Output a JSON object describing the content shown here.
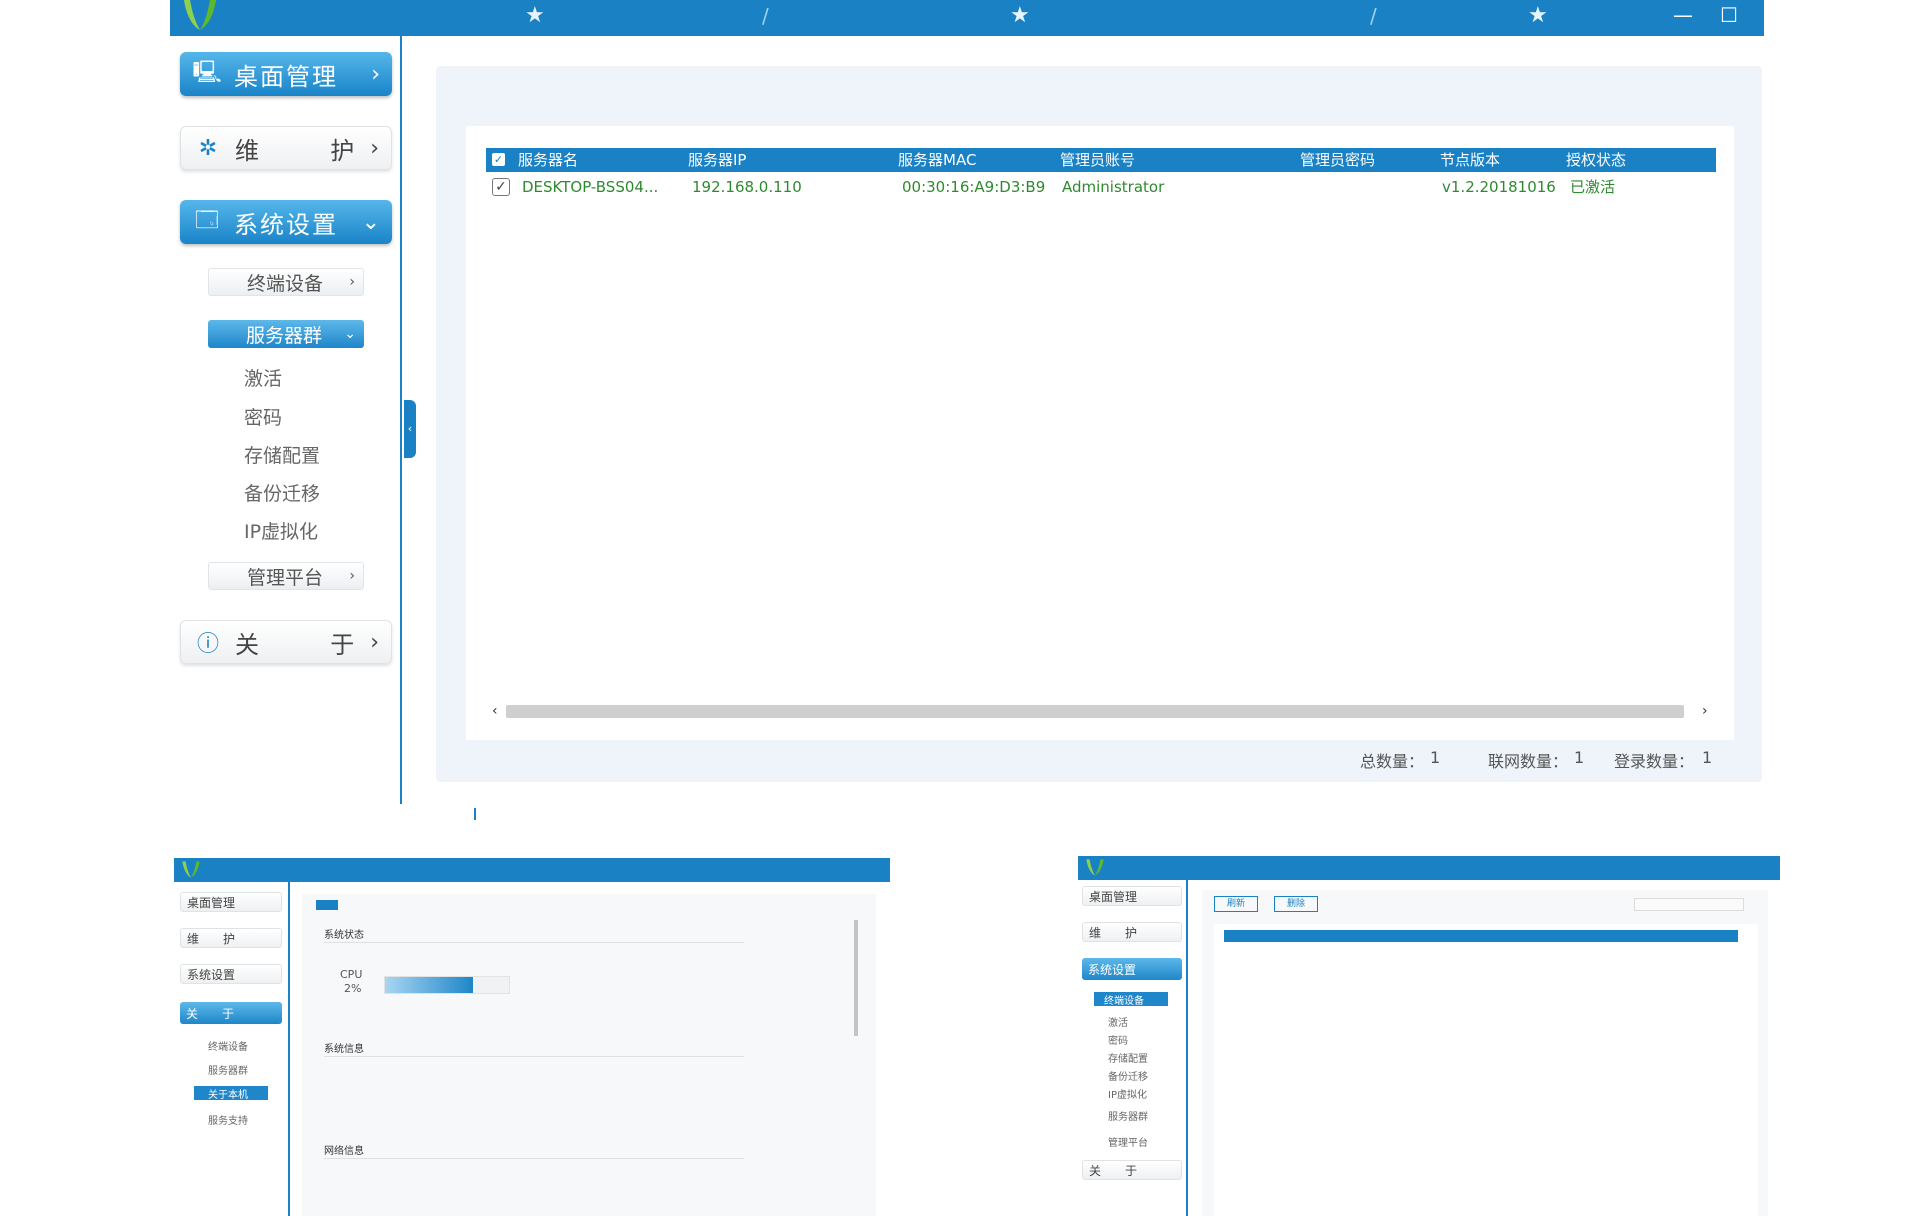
{
  "colors": {
    "accent": "#1a82c4",
    "row_text": "#2f8a2f"
  },
  "window": {
    "logo": "leaf-logo-icon"
  },
  "sidebar": {
    "desktop_mgmt": "桌面管理",
    "maintenance": [
      "维",
      "护"
    ],
    "system_settings": "系统设置",
    "terminal_devices": "终端设备",
    "server_group": "服务器群",
    "sub_items": [
      "激活",
      "密码",
      "存储配置",
      "备份迁移",
      "IP虚拟化"
    ],
    "mgmt_platform": "管理平台",
    "about": [
      "关",
      "于"
    ]
  },
  "table": {
    "headers": [
      "服务器名",
      "服务器IP",
      "服务器MAC",
      "管理员账号",
      "管理员密码",
      "节点版本",
      "授权状态"
    ],
    "rows": [
      {
        "name": "DESKTOP-BSS04...",
        "ip": "192.168.0.110",
        "mac": "00:30:16:A9:D3:B9",
        "admin": "Administrator",
        "password": "",
        "version": "v1.2.20181016",
        "status": "已激活"
      }
    ]
  },
  "footer": {
    "total_label": "总数量：",
    "total_value": "1",
    "online_label": "联网数量：",
    "online_value": "1",
    "login_label": "登录数量：",
    "login_value": "1"
  },
  "thumb_left": {
    "nav": [
      "桌面管理",
      "维　　护",
      "系统设置",
      "关　　于"
    ],
    "subs": [
      "终端设备",
      "服务器群",
      "关于本机",
      "服务支持"
    ],
    "section1": "系统状态",
    "section2": "系统信息",
    "section3": "网络信息",
    "cpu": "CPU",
    "cpu_pct": "2%"
  },
  "thumb_right": {
    "nav": [
      "桌面管理",
      "维　　护",
      "系统设置",
      "关　　于"
    ],
    "subs": [
      "终端设备",
      "激活",
      "密码",
      "存储配置",
      "备份迁移",
      "IP虚拟化",
      "服务器群",
      "管理平台"
    ],
    "tab1": "刷新",
    "tab2": "删除"
  }
}
